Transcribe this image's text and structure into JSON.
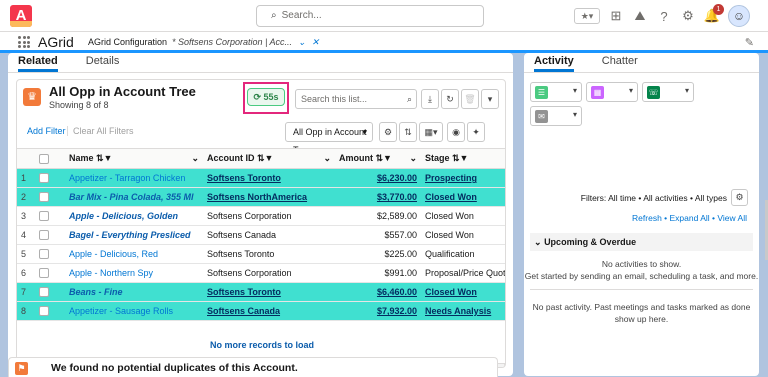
{
  "topbar": {
    "search_placeholder": "Search..."
  },
  "nav": {
    "app_name": "AGrid",
    "tabs": [
      {
        "label": "AGrid Configuration"
      },
      {
        "label": "* Softsens Corporation | Acc..."
      }
    ]
  },
  "record_tabs": [
    "Related",
    "Details"
  ],
  "list": {
    "title": "All Opp in Account Tree",
    "subtitle": "Showing 8 of 8",
    "timer": "55s",
    "search_placeholder": "Search this list...",
    "add_filter": "Add Filter",
    "clear_filters": "Clear All Filters",
    "view_name": "All Opp in Account Tree",
    "columns": [
      "Name",
      "Account ID",
      "Amount",
      "Stage"
    ],
    "rows": [
      {
        "n": "1",
        "name": "Appetizer - Tarragon Chicken",
        "account": "Softsens Toronto",
        "amount": "$6,230.00",
        "stage": "Prospecting",
        "highlight": true,
        "name_style": "link"
      },
      {
        "n": "2",
        "name": "Bar Mix - Pina Colada, 355 Ml",
        "account": "Softsens NorthAmerica",
        "amount": "$3,770.00",
        "stage": "Closed Won",
        "highlight": true,
        "name_style": "bold-italic"
      },
      {
        "n": "3",
        "name": "Apple - Delicious, Golden",
        "account": "Softsens Corporation",
        "amount": "$2,589.00",
        "stage": "Closed Won",
        "highlight": false,
        "name_style": "bold-italic"
      },
      {
        "n": "4",
        "name": "Bagel - Everything Presliced",
        "account": "Softsens Canada",
        "amount": "$557.00",
        "stage": "Closed Won",
        "highlight": false,
        "name_style": "bold-italic"
      },
      {
        "n": "5",
        "name": "Apple - Delicious, Red",
        "account": "Softsens Toronto",
        "amount": "$225.00",
        "stage": "Qualification",
        "highlight": false,
        "name_style": "link"
      },
      {
        "n": "6",
        "name": "Apple - Northern Spy",
        "account": "Softsens Corporation",
        "amount": "$991.00",
        "stage": "Proposal/Price Quote",
        "highlight": false,
        "name_style": "link"
      },
      {
        "n": "7",
        "name": "Beans - Fine",
        "account": "Softsens Toronto",
        "amount": "$6,460.00",
        "stage": "Closed Won",
        "highlight": true,
        "name_style": "bold-italic"
      },
      {
        "n": "8",
        "name": "Appetizer - Sausage Rolls",
        "account": "Softsens Canada",
        "amount": "$7,932.00",
        "stage": "Needs Analysis",
        "highlight": true,
        "name_style": "link"
      }
    ],
    "no_more": "No more records to load"
  },
  "duplicates": {
    "text": "We found no potential duplicates of this Account."
  },
  "activity": {
    "tabs": [
      "Activity",
      "Chatter"
    ],
    "filters": "Filters: All time • All activities • All types",
    "refresh": "Refresh",
    "expand_all": "Expand All",
    "view_all": "View All",
    "upcoming": "Upcoming & Overdue",
    "no_activities": "No activities to show.",
    "get_started": "Get started by sending an email, scheduling a task, and more.",
    "no_past": "No past activity. Past meetings and tasks marked as done show up here."
  },
  "colors": {
    "highlight": "#40e0d0",
    "timer_border": "#e3277c",
    "brand": "#0176d3"
  }
}
